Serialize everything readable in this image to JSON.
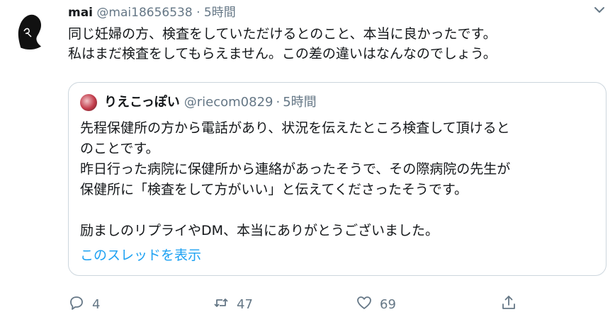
{
  "tweet": {
    "display_name": "mai",
    "handle": "@mai18656538",
    "separator": "·",
    "time": "5時間",
    "lines": [
      "同じ妊婦の方、検査をしていただけるとのこと、本当に良かったです。",
      "私はまだ検査をしてもらえません。この差の違いはなんなのでしょう。"
    ]
  },
  "quote": {
    "display_name": "りえこっぽい",
    "handle": "@riecom0829",
    "separator": "·",
    "time": "5時間",
    "lines": [
      "先程保健所の方から電話があり、状況を伝えたところ検査して頂けると",
      "のことです。",
      "昨日行った病院に保健所から連絡があったそうで、その際病院の先生が",
      "保健所に「検査をして方がいい」と伝えてくださったそうです。",
      "",
      "励ましのリプライやDM、本当にありがとうございました。"
    ],
    "thread_link": "このスレッドを表示"
  },
  "actions": {
    "reply_count": "4",
    "retweet_count": "47",
    "like_count": "69"
  },
  "colors": {
    "text": "#14171a",
    "muted": "#657786",
    "link": "#1da1f2",
    "border": "#ccd6dd"
  },
  "icons": {
    "reply": "reply-icon",
    "retweet": "retweet-icon",
    "like": "heart-icon",
    "share": "share-icon",
    "menu": "chevron-down-icon"
  }
}
